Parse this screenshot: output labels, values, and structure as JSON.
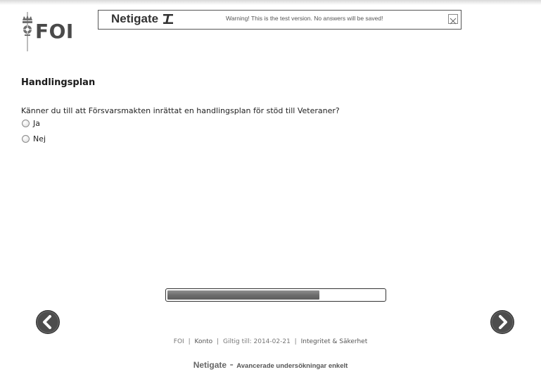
{
  "logo": {
    "text": "FOI",
    "icon": "crown-sword-emblem-icon"
  },
  "banner": {
    "brand": "Netigate",
    "message": "Warning! This is the test version. No answers will be saved!",
    "close_icon": "close-icon"
  },
  "section": {
    "title": "Handlingsplan"
  },
  "question": {
    "text": "Känner du till att Försvarsmakten inrättat en handlingsplan för stöd till Veteraner?",
    "options": [
      {
        "label": "Ja",
        "selected": false
      },
      {
        "label": "Nej",
        "selected": false
      }
    ]
  },
  "progress": {
    "fraction": 0.7
  },
  "nav": {
    "prev_icon": "chevron-left-icon",
    "next_icon": "chevron-right-icon"
  },
  "footer": {
    "company": "FOI",
    "account": "Konto",
    "valid_until": "Giltig till: 2014-02-21",
    "privacy": "Integritet & Säkerhet"
  },
  "brand_footer": {
    "name": "Netigate",
    "separator": "-",
    "tagline": "Avancerade undersökningar enkelt"
  },
  "colors": {
    "nav_button": "#4d4d4d",
    "progress_fill": "#6b6b6b"
  }
}
